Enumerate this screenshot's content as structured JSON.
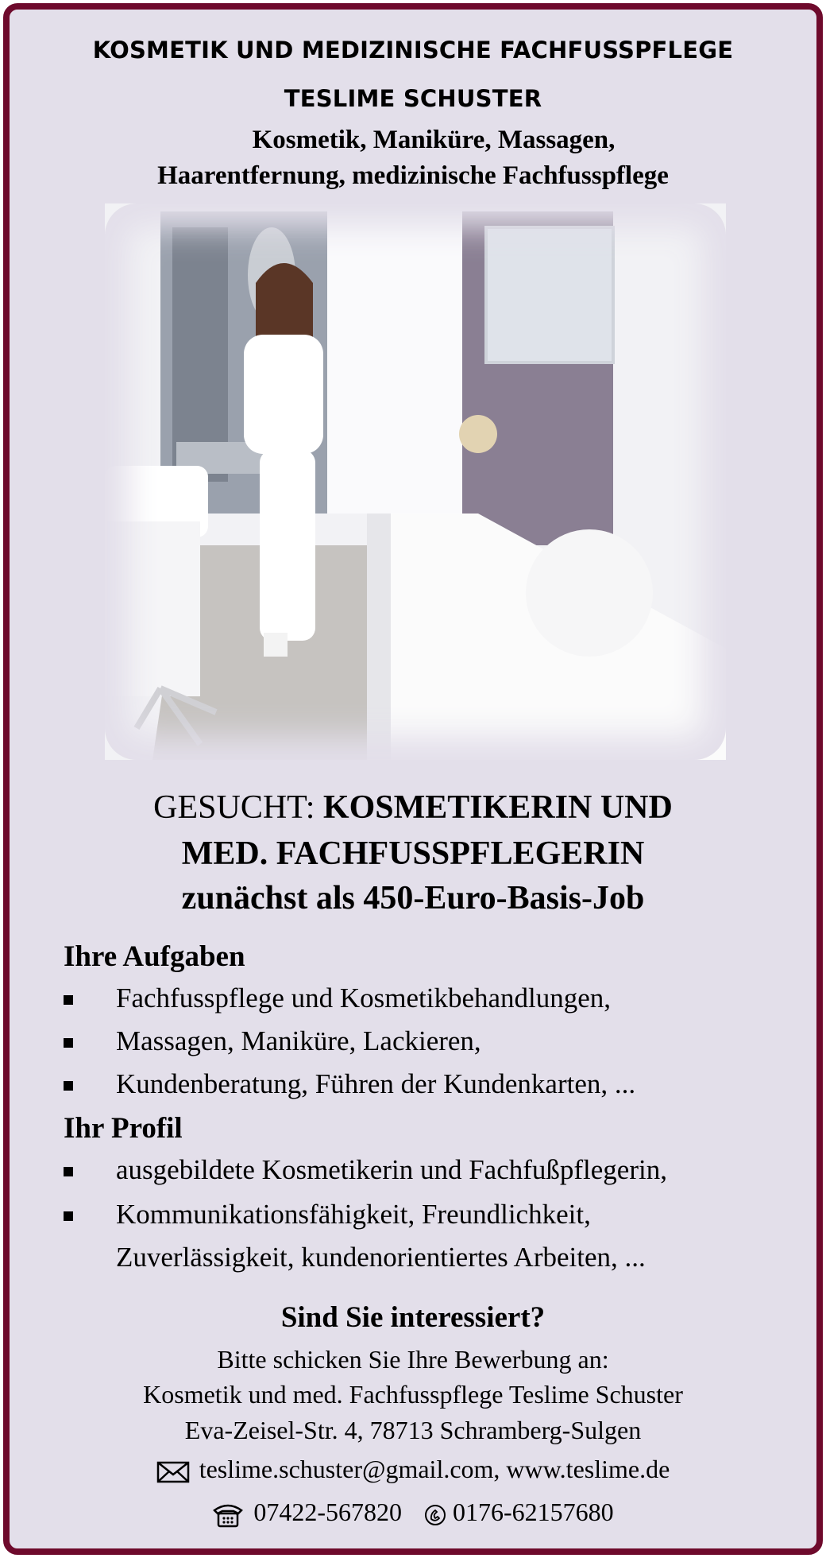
{
  "header": {
    "line1": "KOSMETIK UND MEDIZINISCHE FACHFUSSPFLEGE",
    "line2": "TESLIME SCHUSTER",
    "services1": "Kosmetik, Maniküre, Massagen,",
    "services2": "Haarentfernung, medizinische Fachfusspflege"
  },
  "job": {
    "prefix": "GESUCHT: ",
    "title_part1": "KOSMETIKERIN UND",
    "title_part2": "MED. FACHFUSSPFLEGERIN",
    "title_part3": "zunächst als 450-Euro-Basis-Job"
  },
  "aufgaben": {
    "heading": "Ihre Aufgaben",
    "items": [
      "Fachfusspflege und Kosmetikbehandlungen,",
      "Massagen, Maniküre, Lackieren,",
      "Kundenberatung, Führen der Kundenkarten, ..."
    ]
  },
  "profil": {
    "heading": "Ihr Profil",
    "items": [
      "ausgebildete Kosmetikerin und Fachfußpflegerin,",
      "Kommunikationsfähigkeit, Freundlichkeit,"
    ],
    "continuation": "Zuverlässigkeit, kundenorientiertes Arbeiten, ..."
  },
  "contact": {
    "question": "Sind Sie interessiert?",
    "prompt": "Bitte schicken Sie Ihre Bewerbung an:",
    "company": "Kosmetik und med. Fachfusspflege Teslime Schuster",
    "address": "Eva-Zeisel-Str. 4, 78713 Schramberg-Sulgen",
    "email_web": "teslime.schuster@gmail.com, www.teslime.de",
    "phone": "07422-567820",
    "mobile": "0176-62157680"
  },
  "colors": {
    "border": "#6e0a2c",
    "background": "#e3dfea"
  },
  "icons": [
    "envelope-icon",
    "telephone-icon",
    "mobile-phone-icon"
  ]
}
